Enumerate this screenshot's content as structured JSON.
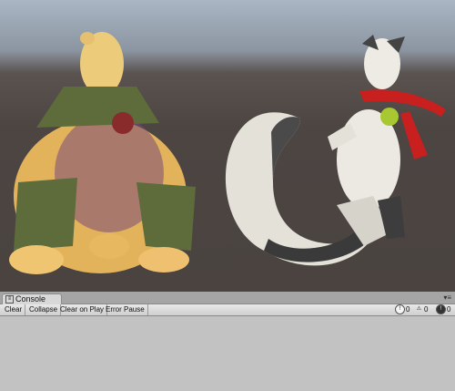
{
  "scene": {
    "characters": [
      {
        "name": "armored-bear",
        "colors": {
          "fur": "#e8b85a",
          "shade": "#6e3d6e",
          "armor": "#5e6b3a"
        }
      },
      {
        "name": "white-fox",
        "colors": {
          "fur": "#e9e6df",
          "shade": "#3b3b3b",
          "scarf": "#c81f1f",
          "bell": "#a8c832"
        }
      }
    ]
  },
  "console": {
    "tab_label": "Console",
    "toolbar": {
      "clear": "Clear",
      "collapse": "Collapse",
      "clear_on_play": "Clear on Play",
      "error_pause": "Error Pause"
    },
    "counts": {
      "info": "0",
      "warnings": "0",
      "errors": "0"
    }
  },
  "colors": {
    "panel_bg": "#c2c2c2",
    "toolbar_bg": "#dcdcdc",
    "scene_bg": "#4a4340"
  }
}
